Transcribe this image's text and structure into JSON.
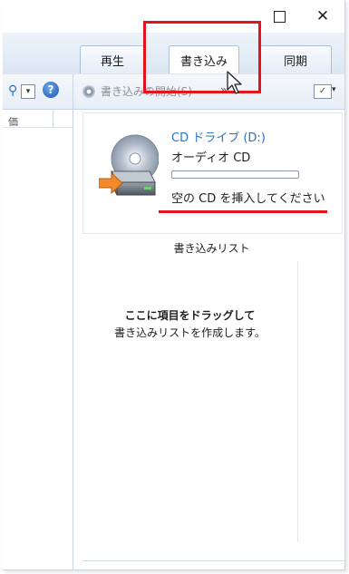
{
  "window": {
    "maximize_glyph": "□",
    "close_glyph": "✕"
  },
  "tabs": [
    {
      "label": "再生",
      "active": false
    },
    {
      "label": "書き込み",
      "active": true
    },
    {
      "label": "同期",
      "active": false
    }
  ],
  "toolbar": {
    "burn_start_label": "書き込みの開始(S)",
    "more_glyph": "»",
    "options_glyph": "✓",
    "dropdown_glyph": "▾",
    "search_glyph": "⚲",
    "help_glyph": "?"
  },
  "left_pane": {
    "column_label": "価"
  },
  "drive": {
    "name": "CD ドライブ (D:)",
    "media_type": "オーディオ CD",
    "progress": 0,
    "status": "空の CD を挿入してください"
  },
  "burn_list": {
    "header": "書き込みリスト",
    "empty_title": "ここに項目をドラッグして",
    "empty_subtitle": "書き込みリストを作成します。"
  },
  "colors": {
    "highlight": "#e3141b",
    "accent_text": "#2a6fc9"
  },
  "icons": [
    "close-icon",
    "maximize-icon",
    "search-icon",
    "help-icon",
    "disc-icon",
    "cd-drive-icon",
    "cursor-icon",
    "list-options-icon"
  ]
}
